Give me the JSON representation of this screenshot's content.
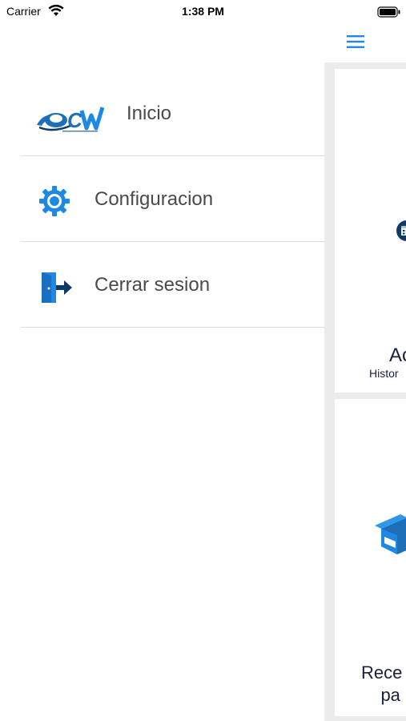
{
  "status_bar": {
    "carrier": "Carrier",
    "time": "1:38 PM"
  },
  "drawer": {
    "items": [
      {
        "label": "Inicio",
        "icon": "app-logo-icon"
      },
      {
        "label": "Configuracion",
        "icon": "gear-icon"
      },
      {
        "label": "Cerrar sesion",
        "icon": "exit-door-icon"
      }
    ]
  },
  "main": {
    "menu_icon": "hamburger-menu-icon",
    "cards": [
      {
        "title": "Ac",
        "subtitle": "Histor",
        "icon": "calendar-icon"
      },
      {
        "title_line1": "Rece",
        "title_line2": "pa",
        "icon": "package-box-icon"
      }
    ]
  },
  "colors": {
    "accent_blue": "#1e88e5",
    "dark_blue": "#0d3b66",
    "text_gray": "#4a4a4a",
    "divider": "#dcdcdc",
    "background_gray": "#ebebeb"
  }
}
